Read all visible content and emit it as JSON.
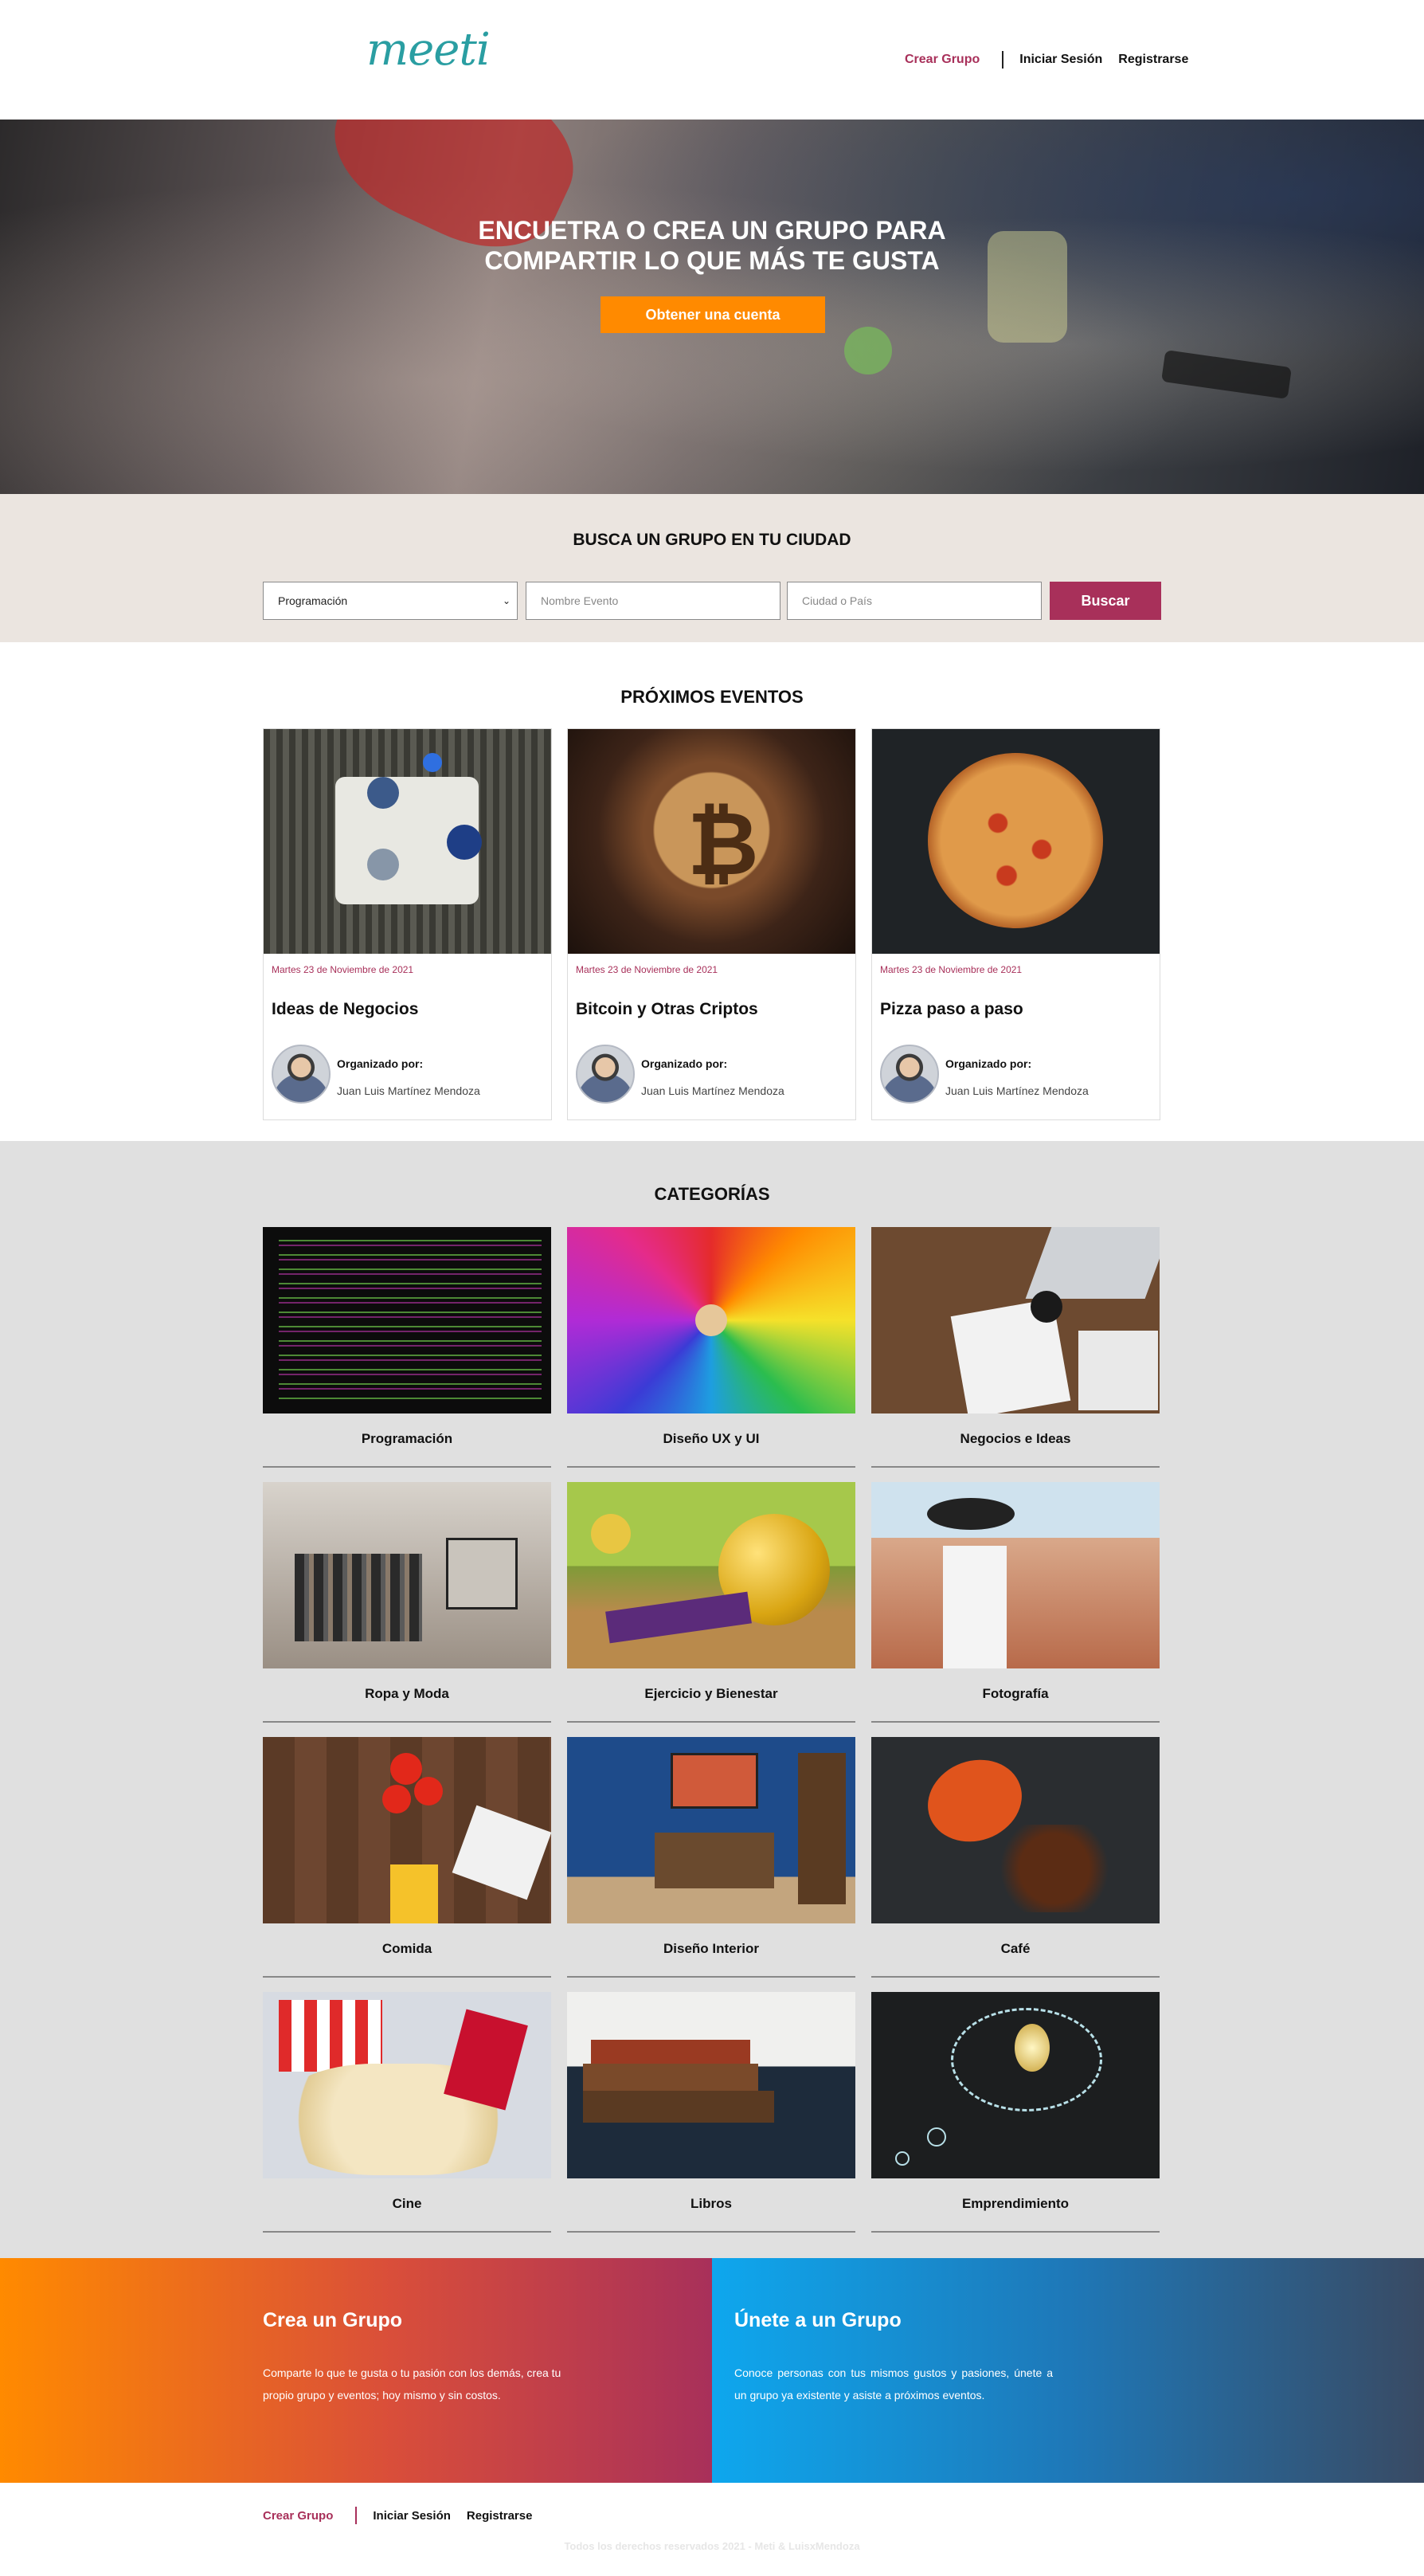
{
  "header": {
    "logo": "meeti",
    "nav": {
      "create": "Crear Grupo",
      "login": "Iniciar Sesión",
      "register": "Registrarse"
    }
  },
  "hero": {
    "title_line1": "Encuetra o crea un grupo para",
    "title_line2": "compartir lo que más te gusta",
    "cta": "Obtener una cuenta"
  },
  "search": {
    "title": "BUSCA UN GRUPO EN TU CIUDAD",
    "category_selected": "Programación",
    "event_placeholder": "Nombre Evento",
    "city_placeholder": "Ciudad o País",
    "button": "Buscar"
  },
  "events": {
    "title": "PRÓXIMOS EVENTOS",
    "organized_label": "Organizado por:",
    "items": [
      {
        "date": "Martes 23 de Noviembre de 2021",
        "title": "Ideas de Negocios",
        "organizer": "Juan Luis Martínez Mendoza"
      },
      {
        "date": "Martes 23 de Noviembre de 2021",
        "title": "Bitcoin y Otras Criptos",
        "organizer": "Juan Luis Martínez Mendoza"
      },
      {
        "date": "Martes 23 de Noviembre de 2021",
        "title": "Pizza paso a paso",
        "organizer": "Juan Luis Martínez Mendoza"
      }
    ]
  },
  "categories": {
    "title": "CATEGORÍAS",
    "items": [
      "Programación",
      "Diseño UX y UI",
      "Negocios e Ideas",
      "Ropa y Moda",
      "Ejercicio y Bienestar",
      "Fotografía",
      "Comida",
      "Diseño Interior",
      "Café",
      "Cine",
      "Libros",
      "Emprendimiento"
    ]
  },
  "cta": {
    "left": {
      "title": "Crea un Grupo",
      "text": "Comparte lo que te gusta o tu pasión con los demás, crea tu propio grupo y eventos; hoy mismo y sin costos."
    },
    "right": {
      "title": "Únete a un Grupo",
      "text": "Conoce personas con tus mismos gustos y pasiones, únete a un grupo ya existente y asiste a próximos eventos."
    }
  },
  "footer": {
    "nav": {
      "create": "Crear Grupo",
      "login": "Iniciar Sesión",
      "register": "Registrarse"
    },
    "copyright": "Todos los derechos reservados 2021 - Meti & LuisxMendoza"
  },
  "colors": {
    "brand": "#a8305a",
    "accent": "#ff8a00",
    "teal": "#2a9ea2"
  }
}
